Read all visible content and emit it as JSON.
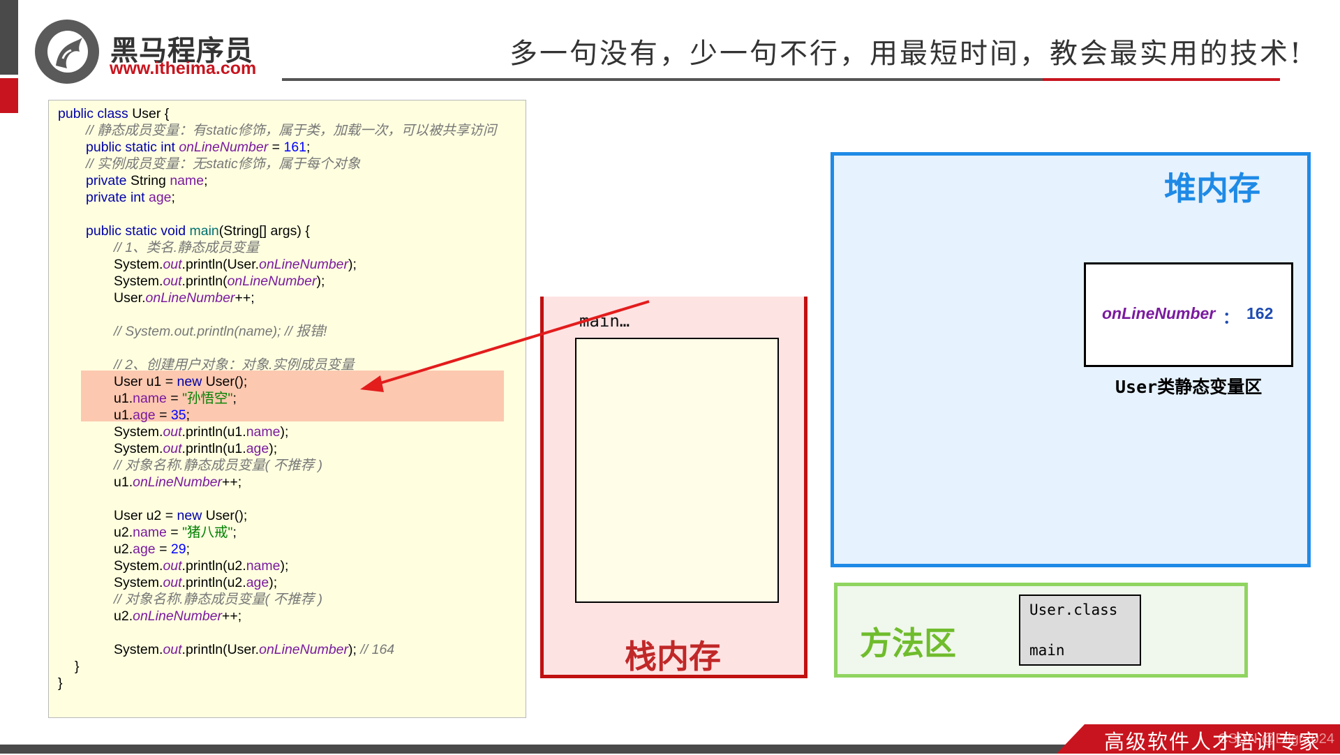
{
  "header": {
    "brand_name": "黑马程序员",
    "brand_url": "www.itheima.com",
    "slogan": "多一句没有，少一句不行，用最短时间，教会最实用的技术!"
  },
  "code": {
    "lines": [
      {
        "indent": 0,
        "parts": [
          {
            "t": "kw",
            "v": "public class "
          },
          {
            "t": "p",
            "v": "User {"
          }
        ]
      },
      {
        "indent": 1,
        "parts": [
          {
            "t": "cmt",
            "v": "// 静态成员变量：有static修饰，属于类，加载一次，可以被共享访问"
          }
        ]
      },
      {
        "indent": 1,
        "parts": [
          {
            "t": "kw",
            "v": "public static int "
          },
          {
            "t": "sfld",
            "v": "onLineNumber"
          },
          {
            "t": "p",
            "v": " = "
          },
          {
            "t": "num",
            "v": "161"
          },
          {
            "t": "p",
            "v": ";"
          }
        ]
      },
      {
        "indent": 1,
        "parts": [
          {
            "t": "cmt",
            "v": "// 实例成员变量：无static修饰，属于每个对象"
          }
        ]
      },
      {
        "indent": 1,
        "parts": [
          {
            "t": "kw",
            "v": "private "
          },
          {
            "t": "p",
            "v": "String "
          },
          {
            "t": "fld",
            "v": "name"
          },
          {
            "t": "p",
            "v": ";"
          }
        ]
      },
      {
        "indent": 1,
        "parts": [
          {
            "t": "kw",
            "v": "private int "
          },
          {
            "t": "fld",
            "v": "age"
          },
          {
            "t": "p",
            "v": ";"
          }
        ]
      },
      {
        "indent": 1,
        "parts": []
      },
      {
        "indent": 1,
        "parts": [
          {
            "t": "kw",
            "v": "public static void "
          },
          {
            "t": "mth",
            "v": "main"
          },
          {
            "t": "p",
            "v": "(String[] args) {"
          }
        ]
      },
      {
        "indent": 2,
        "parts": [
          {
            "t": "cmt",
            "v": "// 1、类名.静态成员变量"
          }
        ]
      },
      {
        "indent": 2,
        "parts": [
          {
            "t": "p",
            "v": "System."
          },
          {
            "t": "sfld",
            "v": "out"
          },
          {
            "t": "p",
            "v": ".println(User."
          },
          {
            "t": "sfld",
            "v": "onLineNumber"
          },
          {
            "t": "p",
            "v": ");"
          }
        ]
      },
      {
        "indent": 2,
        "parts": [
          {
            "t": "p",
            "v": "System."
          },
          {
            "t": "sfld",
            "v": "out"
          },
          {
            "t": "p",
            "v": ".println("
          },
          {
            "t": "sfld",
            "v": "onLineNumber"
          },
          {
            "t": "p",
            "v": ");"
          }
        ]
      },
      {
        "indent": 2,
        "parts": [
          {
            "t": "p",
            "v": "User."
          },
          {
            "t": "sfld",
            "v": "onLineNumber"
          },
          {
            "t": "p",
            "v": "++;"
          }
        ]
      },
      {
        "indent": 2,
        "parts": []
      },
      {
        "indent": 2,
        "parts": [
          {
            "t": "cmt",
            "v": "// System.out.println(name); // 报错!"
          }
        ]
      },
      {
        "indent": 2,
        "parts": []
      },
      {
        "indent": 2,
        "parts": [
          {
            "t": "cmt",
            "v": "// 2、创建用户对象：对象.实例成员变量"
          }
        ]
      },
      {
        "indent": 2,
        "parts": [
          {
            "t": "p",
            "v": "User u1 = "
          },
          {
            "t": "kw",
            "v": "new "
          },
          {
            "t": "p",
            "v": "User();"
          }
        ]
      },
      {
        "indent": 2,
        "parts": [
          {
            "t": "p",
            "v": "u1."
          },
          {
            "t": "fld",
            "v": "name"
          },
          {
            "t": "p",
            "v": " = "
          },
          {
            "t": "str",
            "v": "\"孙悟空\""
          },
          {
            "t": "p",
            "v": ";"
          }
        ]
      },
      {
        "indent": 2,
        "parts": [
          {
            "t": "p",
            "v": "u1."
          },
          {
            "t": "fld",
            "v": "age"
          },
          {
            "t": "p",
            "v": " = "
          },
          {
            "t": "num",
            "v": "35"
          },
          {
            "t": "p",
            "v": ";"
          }
        ]
      },
      {
        "indent": 2,
        "parts": [
          {
            "t": "p",
            "v": "System."
          },
          {
            "t": "sfld",
            "v": "out"
          },
          {
            "t": "p",
            "v": ".println(u1."
          },
          {
            "t": "fld",
            "v": "name"
          },
          {
            "t": "p",
            "v": ");"
          }
        ]
      },
      {
        "indent": 2,
        "parts": [
          {
            "t": "p",
            "v": "System."
          },
          {
            "t": "sfld",
            "v": "out"
          },
          {
            "t": "p",
            "v": ".println(u1."
          },
          {
            "t": "fld",
            "v": "age"
          },
          {
            "t": "p",
            "v": ");"
          }
        ]
      },
      {
        "indent": 2,
        "parts": [
          {
            "t": "cmt",
            "v": "// 对象名称.静态成员变量( 不推荐 )"
          }
        ]
      },
      {
        "indent": 2,
        "parts": [
          {
            "t": "p",
            "v": "u1."
          },
          {
            "t": "sfld",
            "v": "onLineNumber"
          },
          {
            "t": "p",
            "v": "++;"
          }
        ]
      },
      {
        "indent": 2,
        "parts": []
      },
      {
        "indent": 2,
        "parts": [
          {
            "t": "p",
            "v": "User u2 = "
          },
          {
            "t": "kw",
            "v": "new "
          },
          {
            "t": "p",
            "v": "User();"
          }
        ]
      },
      {
        "indent": 2,
        "parts": [
          {
            "t": "p",
            "v": "u2."
          },
          {
            "t": "fld",
            "v": "name"
          },
          {
            "t": "p",
            "v": " = "
          },
          {
            "t": "str",
            "v": "\"猪八戒\""
          },
          {
            "t": "p",
            "v": ";"
          }
        ]
      },
      {
        "indent": 2,
        "parts": [
          {
            "t": "p",
            "v": "u2."
          },
          {
            "t": "fld",
            "v": "age"
          },
          {
            "t": "p",
            "v": " = "
          },
          {
            "t": "num",
            "v": "29"
          },
          {
            "t": "p",
            "v": ";"
          }
        ]
      },
      {
        "indent": 2,
        "parts": [
          {
            "t": "p",
            "v": "System."
          },
          {
            "t": "sfld",
            "v": "out"
          },
          {
            "t": "p",
            "v": ".println(u2."
          },
          {
            "t": "fld",
            "v": "name"
          },
          {
            "t": "p",
            "v": ");"
          }
        ]
      },
      {
        "indent": 2,
        "parts": [
          {
            "t": "p",
            "v": "System."
          },
          {
            "t": "sfld",
            "v": "out"
          },
          {
            "t": "p",
            "v": ".println(u2."
          },
          {
            "t": "fld",
            "v": "age"
          },
          {
            "t": "p",
            "v": ");"
          }
        ]
      },
      {
        "indent": 2,
        "parts": [
          {
            "t": "cmt",
            "v": "// 对象名称.静态成员变量( 不推荐 )"
          }
        ]
      },
      {
        "indent": 2,
        "parts": [
          {
            "t": "p",
            "v": "u2."
          },
          {
            "t": "sfld",
            "v": "onLineNumber"
          },
          {
            "t": "p",
            "v": "++;"
          }
        ]
      },
      {
        "indent": 2,
        "parts": []
      },
      {
        "indent": 2,
        "parts": [
          {
            "t": "p",
            "v": "System."
          },
          {
            "t": "sfld",
            "v": "out"
          },
          {
            "t": "p",
            "v": ".println(User."
          },
          {
            "t": "sfld",
            "v": "onLineNumber"
          },
          {
            "t": "p",
            "v": "); "
          },
          {
            "t": "cmt",
            "v": "// 164"
          }
        ]
      },
      {
        "indent": 0.6,
        "parts": [
          {
            "t": "p",
            "v": "}"
          }
        ]
      },
      {
        "indent": 0,
        "parts": [
          {
            "t": "p",
            "v": "}"
          }
        ]
      }
    ]
  },
  "stack": {
    "frame_label": "main…",
    "title": "栈内存"
  },
  "heap": {
    "title": "堆内存",
    "static_area": {
      "field_name": "onLineNumber",
      "colon": "：",
      "field_value": "162",
      "caption": "User类静态变量区"
    }
  },
  "method_area": {
    "title": "方法区",
    "class_name": "User.class",
    "method_name": "main"
  },
  "footer": {
    "tagline": "高级软件人才培训专家",
    "watermark": "CSDN @Eilgr2024"
  },
  "colors": {
    "brand_red": "#c8141e",
    "heap_blue": "#1e8ae6",
    "stack_red": "#c01010",
    "method_green": "#8fd460",
    "arrow_red": "#e31c1c"
  }
}
